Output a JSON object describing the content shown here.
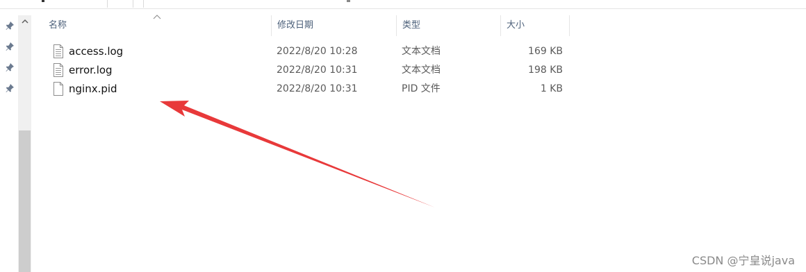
{
  "columns": {
    "name": "名称",
    "date": "修改日期",
    "type": "类型",
    "size": "大小"
  },
  "files": [
    {
      "name": "access.log",
      "date": "2022/8/20 10:28",
      "type": "文本文档",
      "size": "169 KB",
      "icon": "text-document-icon"
    },
    {
      "name": "error.log",
      "date": "2022/8/20 10:31",
      "type": "文本文档",
      "size": "198 KB",
      "icon": "text-document-icon"
    },
    {
      "name": "nginx.pid",
      "date": "2022/8/20 10:31",
      "type": "PID 文件",
      "size": "1 KB",
      "icon": "blank-file-icon"
    }
  ],
  "nav": {
    "pins": [
      "pin-icon",
      "pin-icon",
      "pin-icon",
      "pin-icon"
    ]
  },
  "annotation": {
    "arrow_color": "#e8393a"
  },
  "watermark": "CSDN @宁皇说java",
  "colors": {
    "header_text": "#4c607a",
    "secondary_text": "#5a5a5a"
  }
}
